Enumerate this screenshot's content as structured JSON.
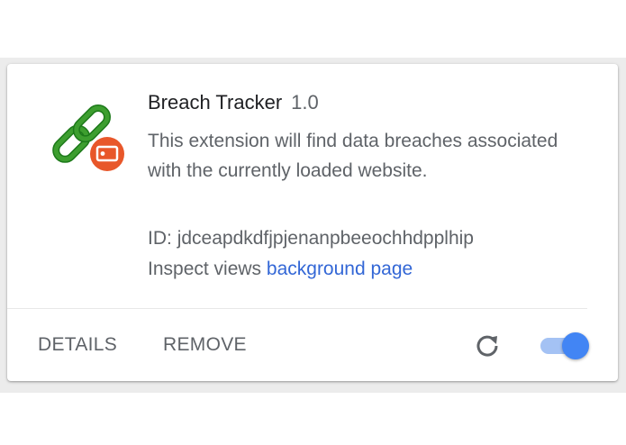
{
  "extension": {
    "name": "Breach Tracker",
    "version": "1.0",
    "description": "This extension will find data breaches associated with the currently loaded website.",
    "id_label": "ID:",
    "id_value": "jdceapdkdfjpjenanpbeeochhdpplhip",
    "inspect_label": "Inspect views",
    "inspect_link": "background page",
    "icon": "chain-link-icon",
    "enabled": true
  },
  "actions": {
    "details_label": "DETAILS",
    "remove_label": "REMOVE",
    "reload_icon": "reload-icon"
  },
  "colors": {
    "link": "#3367d6",
    "toggle_on": "#4285f4",
    "chain_green": "#3d9e2f",
    "badge_orange": "#e8572a"
  }
}
